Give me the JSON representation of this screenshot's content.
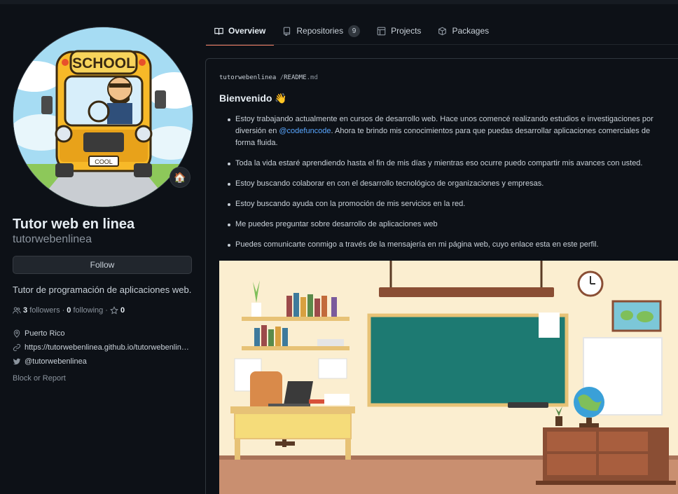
{
  "tabs": [
    {
      "label": "Overview",
      "icon": "book-icon",
      "active": true
    },
    {
      "label": "Repositories",
      "icon": "repo-icon",
      "count": "9"
    },
    {
      "label": "Projects",
      "icon": "project-icon"
    },
    {
      "label": "Packages",
      "icon": "package-icon"
    }
  ],
  "avatar": {
    "bus_sign": "SCHOOL",
    "plate": "COOL",
    "status_emoji": "🏠"
  },
  "profile": {
    "fullname": "Tutor web en linea",
    "username": "tutorwebenlinea",
    "follow_label": "Follow",
    "bio": "Tutor de programación de aplicaciones web.",
    "followers_count": "3",
    "followers_label": "followers",
    "following_count": "0",
    "following_label": "following",
    "stars_count": "0",
    "location": "Puerto Rico",
    "website": "https://tutorwebenlinea.github.io/tutorwebenlinea",
    "twitter": "@tutorwebenlinea",
    "block_report": "Block or Report"
  },
  "readme": {
    "owner": "tutorwebenlinea",
    "separator": "/",
    "file": "README",
    "ext": ".md",
    "heading": "Bienvenido 👋",
    "items": [
      {
        "before": "Estoy trabajando actualmente en cursos de desarrollo web. Hace unos comencé realizando estudios e investigaciones por diversión en ",
        "link": "@codefuncode",
        "after": ". Ahora te brindo mis conocimientos para que puedas desarrollar aplicaciones comerciales de forma fluida."
      },
      {
        "text": "Toda la vida estaré aprendiendo hasta el fin de mis días y mientras eso ocurre puedo compartir mis avances con usted."
      },
      {
        "text": "Estoy buscando colaborar en con el desarrollo tecnológico de organizaciones y empresas."
      },
      {
        "text": "Estoy buscando ayuda con la promoción de mis servicios en la red."
      },
      {
        "text": "Me puedes preguntar sobre desarrollo de aplicaciones web"
      },
      {
        "text": "Puedes comunicarte conmigo a través de la mensajería en mi página web, cuyo enlace esta en este perfil."
      }
    ]
  },
  "colors": {
    "accent": "#f78166",
    "link": "#58a6ff",
    "bg": "#0d1117",
    "border": "#30363d"
  }
}
